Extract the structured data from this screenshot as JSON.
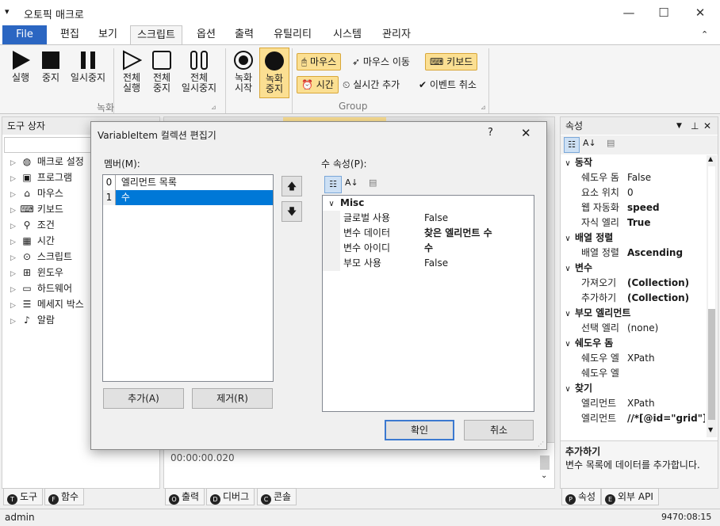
{
  "app": {
    "title": "오토픽 매크로",
    "status_user": "admin",
    "status_time": "9470:08:15"
  },
  "window_controls": {
    "minimize": "—",
    "maximize": "☐",
    "close": "✕"
  },
  "menu_tabs": [
    "File",
    "편집",
    "보기",
    "스크립트",
    "옵션",
    "출력",
    "유틸리티",
    "시스템",
    "관리자"
  ],
  "ribbon": {
    "record_group_label": "녹화",
    "group_label": "Group",
    "buttons": {
      "run": "실행",
      "stop": "중지",
      "pause": "일시중지",
      "run_all_1": "전체",
      "run_all_2": "실행",
      "stop_all_1": "전체",
      "stop_all_2": "중지",
      "pause_all_1": "전체",
      "pause_all_2": "일시중지",
      "rec_start_1": "녹화",
      "rec_start_2": "시작",
      "rec_stop_1": "녹화",
      "rec_stop_2": "중지"
    },
    "mouse": "마우스",
    "mouse_move": "마우스 이동",
    "keyboard": "키보드",
    "time": "시간",
    "realtime_add": "실시간 추가",
    "event_cancel": "이벤트 취소"
  },
  "toolbox": {
    "title": "도구 상자",
    "items": [
      "매크로 설정",
      "프로그램",
      "마우스",
      "키보드",
      "조건",
      "시간",
      "스크립트",
      "윈도우",
      "하드웨어",
      "메세지 박스",
      "알람"
    ]
  },
  "bottom_tabs_left": [
    "도구",
    "함수"
  ],
  "bottom_tabs_left_icons": [
    "T",
    "F"
  ],
  "bottom_tabs_center": [
    "출력",
    "디버그",
    "콘솔"
  ],
  "bottom_tabs_center_icons": [
    "O",
    "D",
    "C"
  ],
  "bottom_tabs_right": [
    "속성",
    "외부 API"
  ],
  "bottom_tabs_right_icons": [
    "P",
    "E"
  ],
  "output": {
    "line": "00:00:00.020"
  },
  "properties": {
    "title": "속성",
    "categories": [
      {
        "name": "동작",
        "rows": [
          [
            "쉐도우 돔",
            "False",
            false
          ],
          [
            "요소 위치",
            "0",
            false
          ],
          [
            "웹 자동화",
            "speed",
            true
          ],
          [
            "자식 엘리",
            "True",
            true
          ]
        ]
      },
      {
        "name": "배열 정렬",
        "rows": [
          [
            "배열 정렬",
            "Ascending",
            true
          ]
        ]
      },
      {
        "name": "변수",
        "rows": [
          [
            "가져오기",
            "(Collection)",
            true
          ],
          [
            "추가하기",
            "(Collection)",
            true
          ]
        ]
      },
      {
        "name": "부모 엘리먼트",
        "rows": [
          [
            "선택 엘리",
            "(none)",
            false
          ]
        ]
      },
      {
        "name": "쉐도우 돔",
        "rows": [
          [
            "쉐도우 엘",
            "XPath",
            false
          ],
          [
            "쉐도우 엘",
            "",
            false
          ]
        ]
      },
      {
        "name": "찾기",
        "rows": [
          [
            "엘리먼트",
            "XPath",
            false
          ],
          [
            "엘리먼트",
            "//*[@id=\"grid\"]",
            true
          ]
        ]
      }
    ],
    "desc_title": "추가하기",
    "desc_text": "변수 목록에 데이터를 추가합니다."
  },
  "dialog": {
    "title": "VariableItem 컬렉션 편집기",
    "help": "?",
    "close": "✕",
    "members_label": "멤버(M):",
    "members": [
      {
        "index": "0",
        "name": "엘리먼트 목록"
      },
      {
        "index": "1",
        "name": "수"
      }
    ],
    "props_label": "수 속성(P):",
    "category": "Misc",
    "props": [
      [
        "글로벌 사용",
        "False",
        false
      ],
      [
        "변수 데이터",
        "찾은 엘리먼트 수",
        true
      ],
      [
        "변수 아이디",
        "수",
        true
      ],
      [
        "부모 사용",
        "False",
        false
      ]
    ],
    "add_button": "추가(A)",
    "remove_button": "제거(R)",
    "ok_button": "확인",
    "cancel_button": "취소"
  },
  "colors": {
    "accent": "#2b66c2",
    "highlight": "#fbdf92",
    "selection": "#0078d7"
  }
}
